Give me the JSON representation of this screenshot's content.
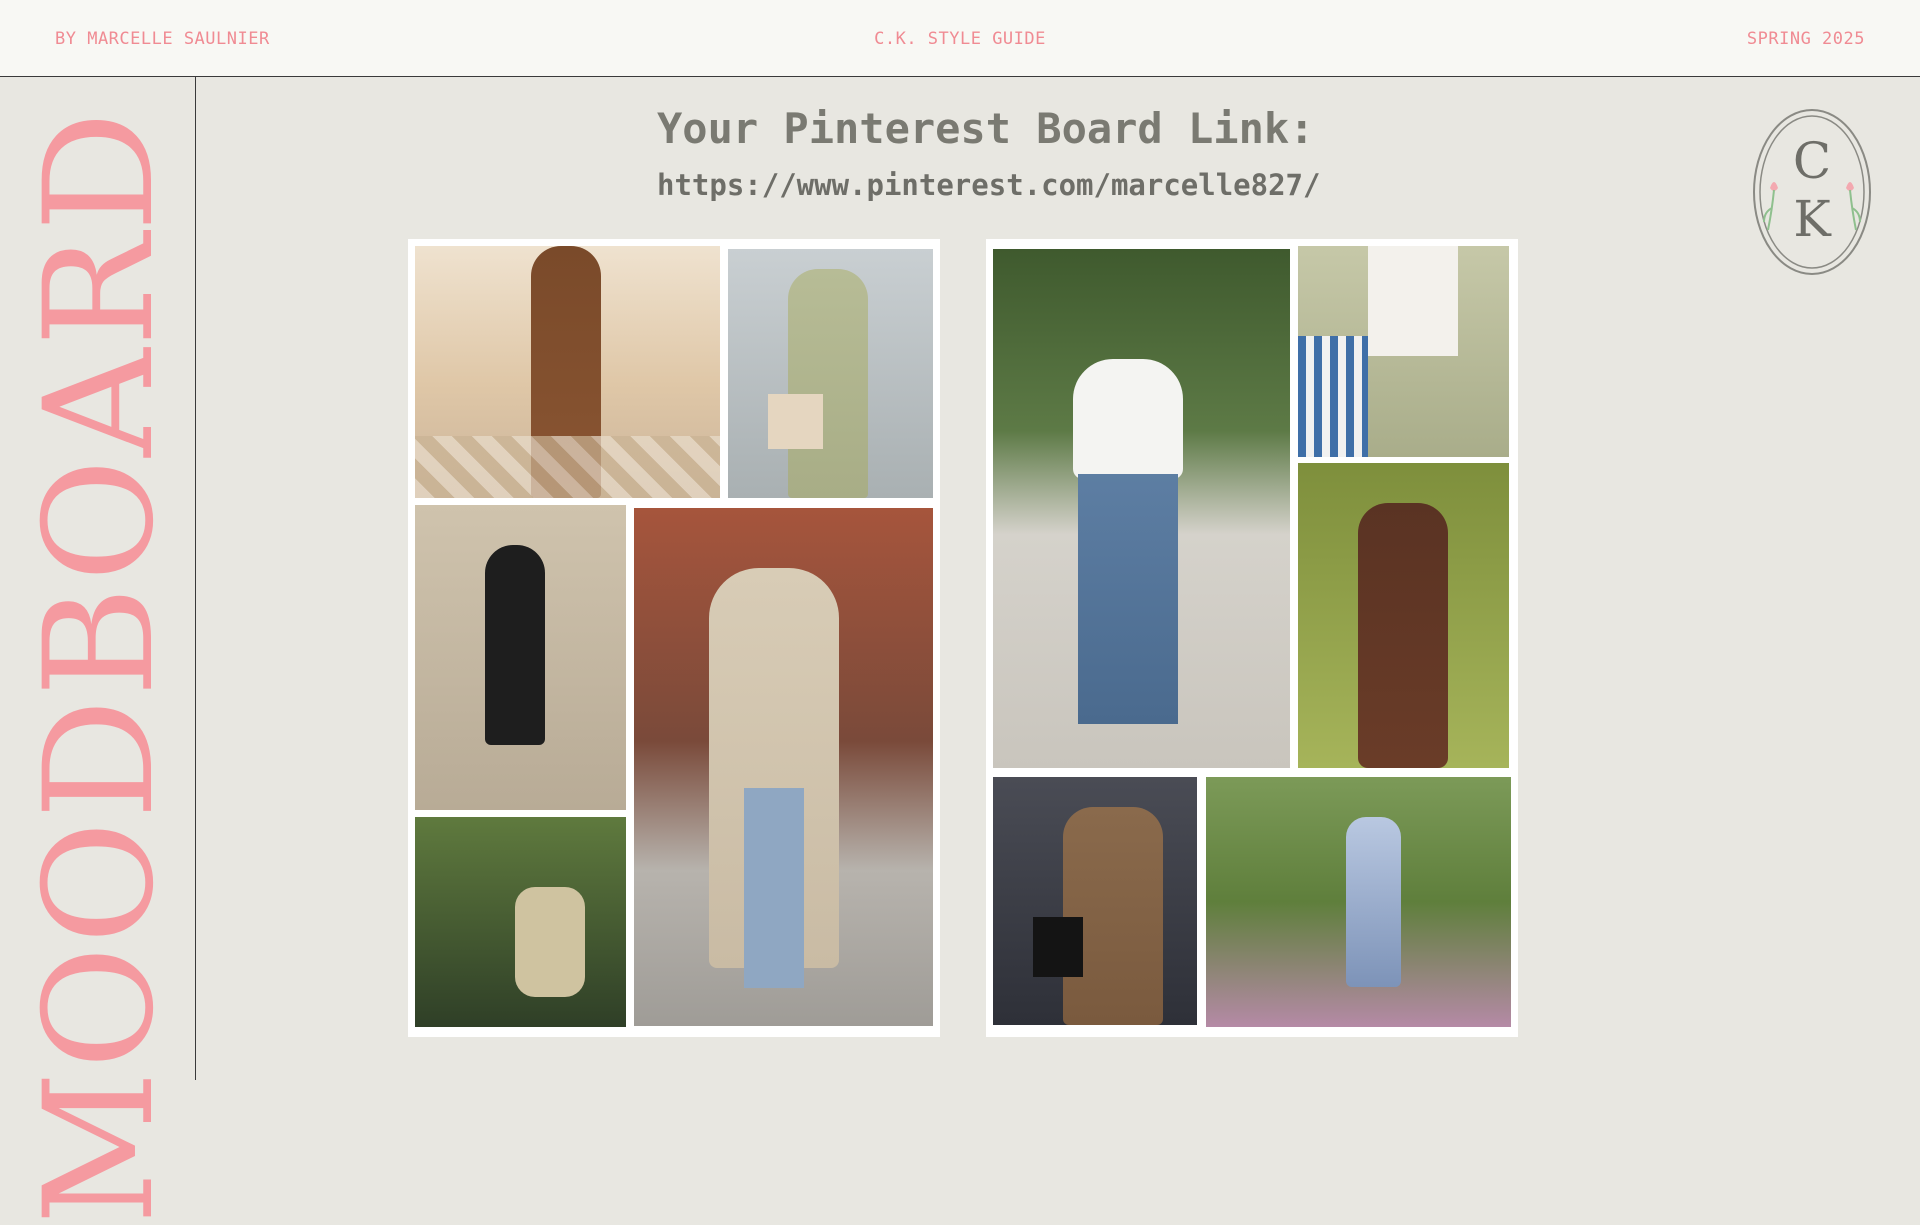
{
  "header": {
    "author": "BY MARCELLE SAULNIER",
    "guide_title": "C.K. STYLE GUIDE",
    "season": "SPRING 2025"
  },
  "sidebar": {
    "title": "MOODBOARD"
  },
  "main": {
    "heading": "Your Pinterest Board Link:",
    "link": "https://www.pinterest.com/marcelle827/"
  },
  "logo": {
    "monogram_top": "C",
    "monogram_bottom": "K"
  },
  "colors": {
    "accent_pink": "#f08b93",
    "title_pink": "#f59aa0",
    "background": "#e8e7e1",
    "header_bg": "#f8f8f4",
    "text_gray": "#7a7a72"
  }
}
